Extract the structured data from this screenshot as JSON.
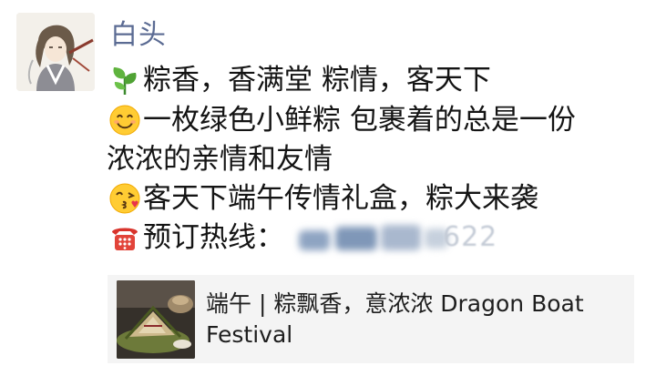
{
  "post": {
    "nickname": "白头",
    "lines": [
      {
        "emoji": "herb-icon",
        "text": "粽香，香满堂 粽情，客天下"
      },
      {
        "emoji": "smiling-face-icon",
        "text": "一枚绿色小鲜粽 包裹着的总是一份"
      },
      {
        "emoji": "",
        "text": "浓浓的亲情和友情"
      },
      {
        "emoji": "kissing-face-icon",
        "text": "客天下端午传情礼盒，粽大来袭"
      },
      {
        "emoji": "telephone-icon",
        "text": "预订热线：",
        "blurred_tail": "622"
      }
    ],
    "shared_link": {
      "title": "端午 | 粽飘香，意浓浓 Dragon Boat Festival"
    }
  }
}
